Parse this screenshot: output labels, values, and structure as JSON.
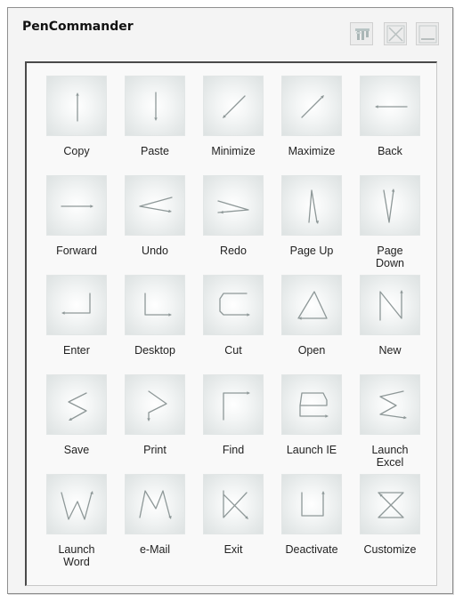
{
  "window": {
    "title": "PenCommander"
  },
  "title_buttons": [
    {
      "name": "settings-icon"
    },
    {
      "name": "close-icon"
    },
    {
      "name": "minimize-icon"
    }
  ],
  "gestures": [
    {
      "label": "Copy",
      "icon": "stroke-up-icon"
    },
    {
      "label": "Paste",
      "icon": "stroke-down-icon"
    },
    {
      "label": "Minimize",
      "icon": "stroke-down-left-icon"
    },
    {
      "label": "Maximize",
      "icon": "stroke-up-right-icon"
    },
    {
      "label": "Back",
      "icon": "stroke-left-icon"
    },
    {
      "label": "Forward",
      "icon": "stroke-right-icon"
    },
    {
      "label": "Undo",
      "icon": "stroke-less-than-icon"
    },
    {
      "label": "Redo",
      "icon": "stroke-greater-than-icon"
    },
    {
      "label": "Page Up",
      "icon": "stroke-caret-up-icon"
    },
    {
      "label": "Page\nDown",
      "icon": "stroke-v-icon"
    },
    {
      "label": "Enter",
      "icon": "stroke-enter-icon"
    },
    {
      "label": "Desktop",
      "icon": "stroke-l-icon"
    },
    {
      "label": "Cut",
      "icon": "stroke-c-icon"
    },
    {
      "label": "Open",
      "icon": "stroke-triangle-icon"
    },
    {
      "label": "New",
      "icon": "stroke-n-icon"
    },
    {
      "label": "Save",
      "icon": "stroke-s-icon"
    },
    {
      "label": "Print",
      "icon": "stroke-p-icon"
    },
    {
      "label": "Find",
      "icon": "stroke-f-icon"
    },
    {
      "label": "Launch IE",
      "icon": "stroke-e-icon"
    },
    {
      "label": "Launch\nExcel",
      "icon": "stroke-sigma-icon"
    },
    {
      "label": "Launch\nWord",
      "icon": "stroke-w-icon"
    },
    {
      "label": "e-Mail",
      "icon": "stroke-m-icon"
    },
    {
      "label": "Exit",
      "icon": "stroke-x-icon"
    },
    {
      "label": "Deactivate",
      "icon": "stroke-u-icon"
    },
    {
      "label": "Customize",
      "icon": "stroke-hourglass-icon"
    }
  ]
}
